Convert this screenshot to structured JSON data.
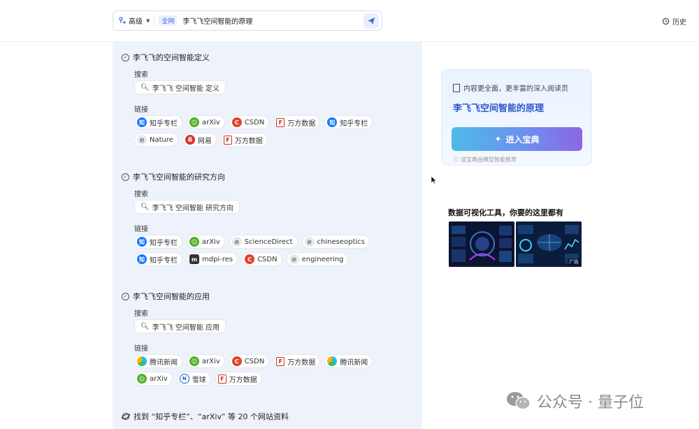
{
  "header": {
    "advanced_label": "高级",
    "scope_label": "全网",
    "query": "李飞飞空间智能的原理",
    "history_label": "历史"
  },
  "sections": [
    {
      "title": "李飞飞的空间智能定义",
      "search_label": "搜索",
      "search_query": "李飞飞 空间智能 定义",
      "links_label": "链接",
      "links": [
        {
          "icon": "zhihu-icon",
          "label": "知乎专栏"
        },
        {
          "icon": "arxiv-icon",
          "label": "arXiv"
        },
        {
          "icon": "csdn-icon",
          "label": "CSDN"
        },
        {
          "icon": "wanfang-icon",
          "label": "万方数据"
        },
        {
          "icon": "zhihu-icon",
          "label": "知乎专栏"
        },
        {
          "icon": "generic-site-icon",
          "label": "Nature"
        },
        {
          "icon": "netease-icon",
          "label": "网易"
        },
        {
          "icon": "wanfang-icon",
          "label": "万方数据"
        }
      ]
    },
    {
      "title": "李飞飞空间智能的研究方向",
      "search_label": "搜索",
      "search_query": "李飞飞 空间智能 研究方向",
      "links_label": "链接",
      "links": [
        {
          "icon": "zhihu-icon",
          "label": "知乎专栏"
        },
        {
          "icon": "arxiv-icon",
          "label": "arXiv"
        },
        {
          "icon": "generic-site-icon",
          "label": "ScienceDirect"
        },
        {
          "icon": "generic-site-icon",
          "label": "chineseoptics"
        },
        {
          "icon": "zhihu-icon",
          "label": "知乎专栏"
        },
        {
          "icon": "mdpi-icon",
          "label": "mdpi-res"
        },
        {
          "icon": "csdn-icon",
          "label": "CSDN"
        },
        {
          "icon": "generic-site-icon",
          "label": "engineering"
        }
      ]
    },
    {
      "title": "李飞飞空间智能的应用",
      "search_label": "搜索",
      "search_query": "李飞飞 空间智能 应用",
      "links_label": "链接",
      "links": [
        {
          "icon": "tencent-icon",
          "label": "腾讯新闻"
        },
        {
          "icon": "arxiv-icon",
          "label": "arXiv"
        },
        {
          "icon": "csdn-icon",
          "label": "CSDN"
        },
        {
          "icon": "wanfang-icon",
          "label": "万方数据"
        },
        {
          "icon": "tencent-icon",
          "label": "腾讯新闻"
        },
        {
          "icon": "arxiv-icon",
          "label": "arXiv"
        },
        {
          "icon": "guanqiu-icon",
          "label": "雪球"
        },
        {
          "icon": "wanfang-icon",
          "label": "万方数据"
        }
      ]
    }
  ],
  "footer": {
    "summary": "找到 “知乎专栏”、“arXiv” 等 20 个网站资料"
  },
  "card": {
    "hint": "内容更全面，更丰富的深入阅读页",
    "title": "李飞飞空间智能的原理",
    "button_label": "进入宝典",
    "note": "该宝典由模型智能推荐"
  },
  "ad": {
    "title": "数据可视化工具，你要的这里都有",
    "tag": "广告"
  },
  "watermark": {
    "text": "公众号 · 量子位"
  },
  "colors": {
    "accent": "#2b56c9",
    "panel_bg": "#eef3fb",
    "zhihu": "#1677ff",
    "arxiv": "#52b12c",
    "csdn": "#e0452d"
  }
}
